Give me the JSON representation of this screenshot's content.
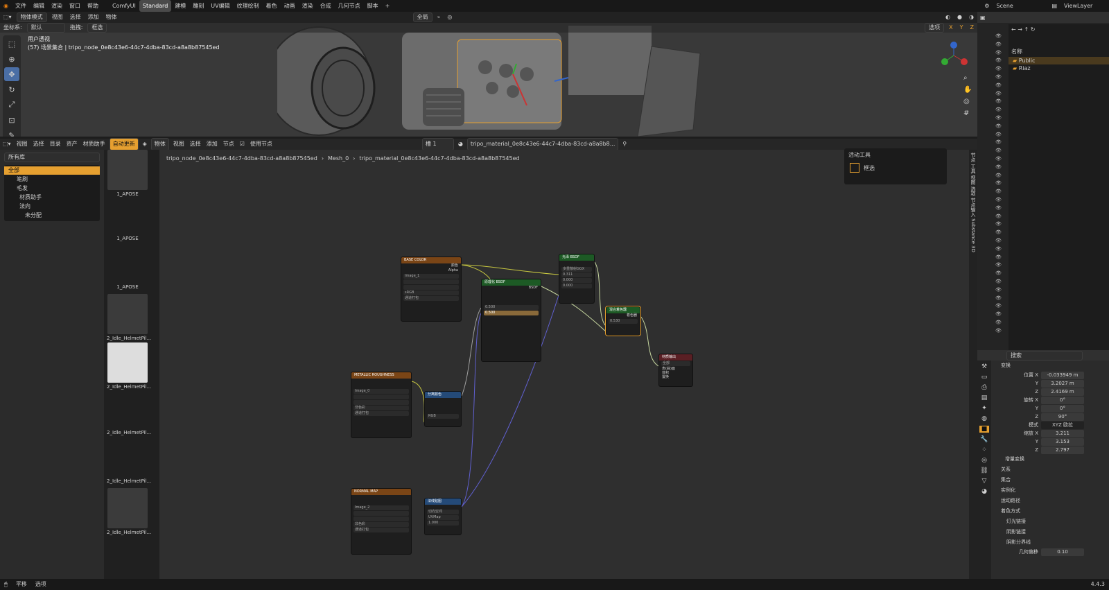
{
  "menu": [
    "文件",
    "编辑",
    "渲染",
    "窗口",
    "帮助"
  ],
  "workspaces": [
    "ComfyUI",
    "Standard",
    "建模",
    "雕刻",
    "UV编辑",
    "纹理绘制",
    "着色",
    "动画",
    "渲染",
    "合成",
    "几何节点",
    "脚本"
  ],
  "scene": {
    "name": "Scene",
    "view_layer": "ViewLayer"
  },
  "viewport": {
    "mode": "物体模式",
    "menus": [
      "视图",
      "选择",
      "添加",
      "物体"
    ],
    "coord_label": "坐标系:",
    "coord_value": "默认",
    "drag_label": "拖拽:",
    "drag_value": "框选",
    "pivot": "全局",
    "options": "选项",
    "view_name": "用户透视",
    "collection_info": "(57) 场景集合 | tripo_node_0e8c43e6-44c7-4dba-83cd-a8a8b87545ed",
    "axes": [
      "X",
      "Y",
      "Z"
    ]
  },
  "node_header": {
    "menus": [
      "视图",
      "选择",
      "目录",
      "资产",
      "材质助手"
    ],
    "auto_update": "自动更新",
    "object": "物体",
    "menus2": [
      "视图",
      "选择",
      "添加",
      "节点"
    ],
    "use_nodes": "使用节点",
    "slot": "槽 1",
    "material": "tripo_material_0e8c43e6-44c7-4dba-83cd-a8a8b8..."
  },
  "breadcrumb": {
    "node": "tripo_node_0e8c43e6-44c7-4dba-83cd-a8a8b87545ed",
    "mesh": "Mesh_0",
    "material": "tripo_material_0e8c43e6-44c7-4dba-83cd-a8a8b87545ed"
  },
  "asset_browser": {
    "library": "所有库",
    "root": "全部",
    "items": [
      "笔刷",
      "毛发",
      "材质助手",
      "法向",
      "未分配"
    ]
  },
  "thumbs": [
    "1_APOSE",
    "1_APOSE",
    "1_APOSE",
    "2_Idle_HelmetPil...",
    "2_Idle_HelmetPil...",
    "2_Idle_HelmetPil...",
    "2_Idle_HelmetPil...",
    "2_Idle_HelmetPil..."
  ],
  "active_tool": {
    "title": "活动工具",
    "tool": "框选"
  },
  "nodes": {
    "base_color": {
      "title": "BASE COLOR",
      "image": "Image_1",
      "color_space": "sRGB",
      "alpha": "通道打包",
      "out1": "颜色",
      "out2": "Alpha"
    },
    "metal": {
      "title": "METALLIC ROUGHNESS",
      "image": "Image_0",
      "color_space": "非色彩",
      "alpha": "通道打包"
    },
    "normal_map": {
      "title": "NORMAL MAP",
      "image": "Image_2",
      "color_space": "非色彩",
      "alpha": "通道打包"
    },
    "separate": {
      "title": "分离颜色",
      "mode": "RGB"
    },
    "normal": {
      "title": "法线贴图",
      "space": "切向空间",
      "uv": "UVMap",
      "strength": "1.000"
    },
    "principled": {
      "title": "原理化 BSDF",
      "out": "BSDF",
      "metal": "0.500",
      "rough": "0.500"
    },
    "glossy": {
      "title": "光泽 BSDF",
      "dist": "多重散射GGX",
      "v1": "0.311",
      "v2": "0.000",
      "v3": "0.000"
    },
    "mix": {
      "title": "混合着色器",
      "fac": "0.530",
      "out": "着色器"
    },
    "output": {
      "title": "材质输出",
      "target": "全部",
      "sockets": [
        "表(曲)面",
        "体积",
        "置换",
        "厚(度)度"
      ]
    }
  },
  "side_tabs": [
    "节点",
    "工具",
    "视图",
    "选项",
    "节点输入",
    "Substance 3D"
  ],
  "outliner": {
    "header": "名称",
    "items": [
      "Public",
      "Riaz"
    ]
  },
  "properties": {
    "search": "搜索",
    "transform": "变换",
    "location": {
      "label": "位置 X",
      "x": "-0.033949 m",
      "y": "3.2027 m",
      "z": "2.4169 m"
    },
    "rotation": {
      "label": "旋转 X",
      "x": "0°",
      "y": "0°",
      "z": "90°"
    },
    "mode_label": "模式",
    "mode": "XYZ 欧拉",
    "scale": {
      "label": "缩放 X",
      "x": "3.211",
      "y": "3.153",
      "z": "2.797"
    },
    "sections": [
      "增量变换",
      "关系",
      "集合",
      "实例化",
      "运动路径",
      "着色方式",
      "灯光链接",
      "阴影链接",
      "阴影分界线"
    ],
    "geo_offset_label": "几何偏移",
    "geo_offset": "0.10"
  },
  "status": {
    "left1": "平移",
    "left2": "选项",
    "version": "4.4.3"
  }
}
